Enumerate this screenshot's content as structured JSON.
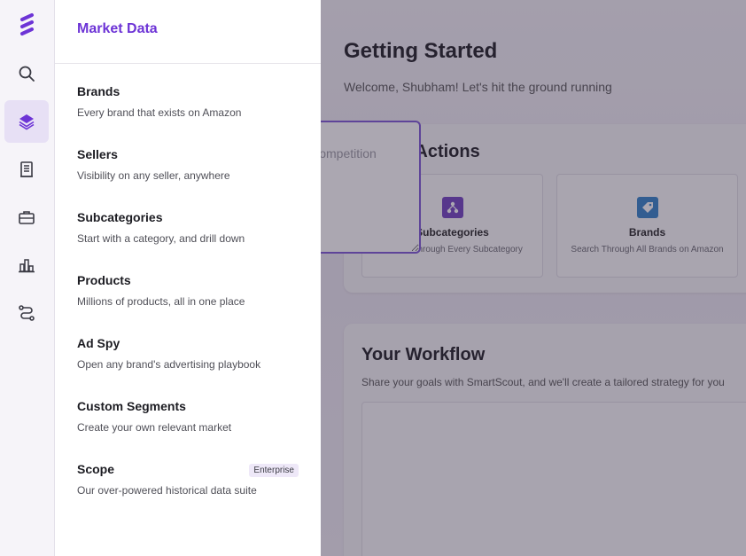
{
  "main": {
    "title": "Getting Started",
    "subtitle": "Welcome, Shubham! Let's hit the ground running",
    "quick_actions": {
      "title": "Quick Actions",
      "tiles": [
        {
          "title": "Subcategories",
          "desc": "Search Through Every Subcategory",
          "icon": "sitemap-icon",
          "color": "#6f3fbf"
        },
        {
          "title": "Brands",
          "desc": "Search Through All Brands on Amazon",
          "icon": "tag-icon",
          "color": "#2f80c9"
        }
      ]
    },
    "workflow": {
      "title": "Your Workflow",
      "desc": "Share your goals with SmartScout, and we'll create a tailored strategy for you",
      "placeholder": "e.g. I want to find a high-traffic niche with low competition"
    }
  },
  "rail": {
    "items": [
      {
        "name": "search",
        "icon": "search-icon",
        "active": false
      },
      {
        "name": "market-data",
        "icon": "layers-icon",
        "active": true
      },
      {
        "name": "reports",
        "icon": "document-icon",
        "active": false
      },
      {
        "name": "tools",
        "icon": "briefcase-icon",
        "active": false
      },
      {
        "name": "analytics",
        "icon": "bar-chart-icon",
        "active": false
      },
      {
        "name": "workflows",
        "icon": "route-icon",
        "active": false
      }
    ]
  },
  "panel": {
    "title": "Market Data",
    "items": [
      {
        "title": "Brands",
        "desc": "Every brand that exists on Amazon"
      },
      {
        "title": "Sellers",
        "desc": "Visibility on any seller, anywhere"
      },
      {
        "title": "Subcategories",
        "desc": "Start with a category, and drill down"
      },
      {
        "title": "Products",
        "desc": "Millions of products, all in one place"
      },
      {
        "title": "Ad Spy",
        "desc": "Open any brand's advertising playbook"
      },
      {
        "title": "Custom Segments",
        "desc": "Create your own relevant market"
      },
      {
        "title": "Scope",
        "desc": "Our over-powered historical data suite",
        "badge": "Enterprise"
      }
    ]
  },
  "colors": {
    "accent": "#6d34d6",
    "rail_active": "#e7e0f5"
  }
}
